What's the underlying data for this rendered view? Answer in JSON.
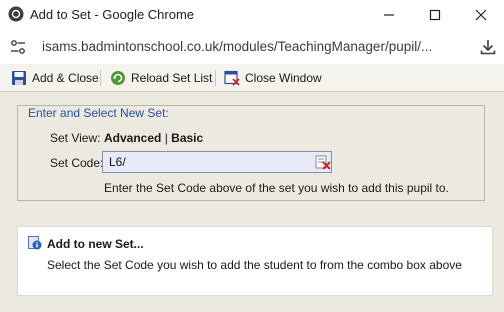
{
  "window": {
    "title": "Add to Set - Google Chrome"
  },
  "address": {
    "url": "isams.badmintonschool.co.uk/modules/TeachingManager/pupil/..."
  },
  "toolbar": {
    "add_close": "Add & Close",
    "reload": "Reload Set List",
    "close_window": "Close Window"
  },
  "form": {
    "legend": "Enter and Select New Set:",
    "view_label": "Set View:",
    "view_advanced": "Advanced",
    "view_sep": " | ",
    "view_basic": "Basic",
    "code_label": "Set Code:",
    "code_value": "L6/",
    "hint": "Enter the Set Code above of the set you wish to add this pupil to."
  },
  "panel": {
    "title": "Add to new Set...",
    "description": "Select the Set Code you wish to add the student to from the combo box above"
  },
  "colors": {
    "legend": "#2a4f9c",
    "background": "#eceae0",
    "input_bg": "#e8ebf6"
  }
}
